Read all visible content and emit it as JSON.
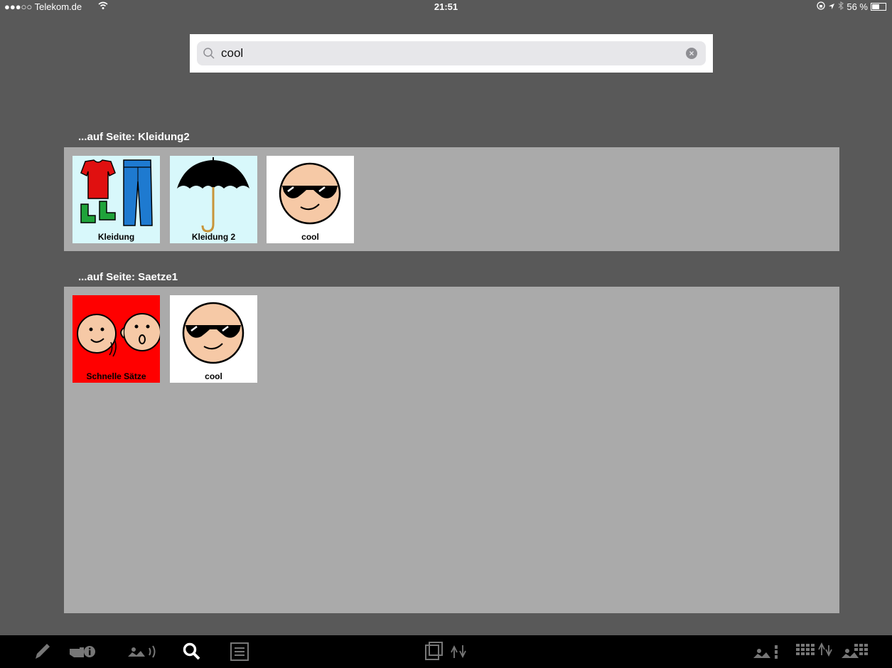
{
  "status_bar": {
    "carrier": "●●●○○ Telekom.de",
    "time": "21:51",
    "battery": "56 %",
    "battery_level": 0.56
  },
  "search": {
    "value": "cool",
    "placeholder": ""
  },
  "sections": [
    {
      "title": "...auf Seite: Kleidung2",
      "tiles": [
        {
          "label": "Kleidung",
          "background": "#d8f8fb",
          "icon": "clothes-icon"
        },
        {
          "label": "Kleidung 2",
          "background": "#d8f8fb",
          "icon": "umbrella-icon"
        },
        {
          "label": "cool",
          "background": "#ffffff",
          "icon": "cool-face-icon"
        }
      ]
    },
    {
      "title": "...auf Seite: Saetze1",
      "tiles": [
        {
          "label": "Schnelle Sätze",
          "background": "#ff0000",
          "icon": "talking-faces-icon"
        },
        {
          "label": "cool",
          "background": "#ffffff",
          "icon": "cool-face-icon"
        }
      ]
    }
  ],
  "toolbar": {
    "left": [
      "edit-pencil-icon",
      "pointing-info-icon",
      "speak-icon",
      "search-icon",
      "list-icon"
    ],
    "center": [
      "page-sort-icon"
    ],
    "right": [
      "column-add-icon",
      "grid-sort-icon",
      "grid-settings-icon"
    ]
  },
  "colors": {
    "background": "#595959",
    "panel": "#aaaaaa",
    "toolbar": "#000000",
    "active_icon": "#ffffff",
    "inactive_icon": "#777777"
  }
}
